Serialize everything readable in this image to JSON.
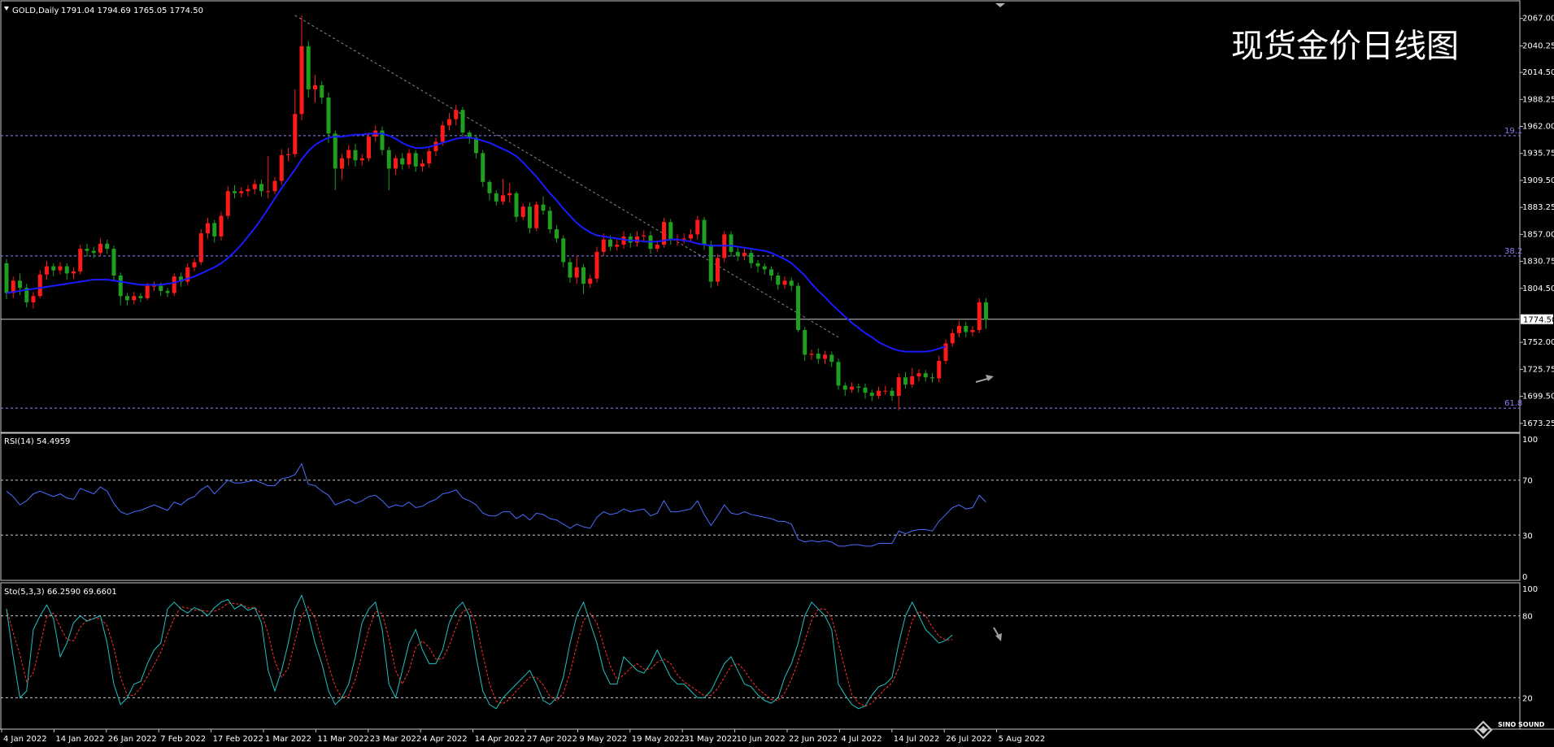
{
  "header": {
    "symbol": "GOLD,Daily",
    "ohlc": "1791.04 1794.69 1765.05 1774.50",
    "annotation": "现货金价日线图"
  },
  "colors": {
    "background": "#000000",
    "bull": "#ff1a1a",
    "bear": "#1f9e1f",
    "ma": "#1a1aff",
    "rsi": "#4a6cff",
    "sto_main": "#20c0c0",
    "sto_signal": "#ff3030",
    "grid_dash": "#8a8aff",
    "trendline": "#8a8a8a",
    "arrow": "#a0a0a0"
  },
  "price_panel": {
    "ticks": [
      "2067.00",
      "2040.25",
      "2014.50",
      "1988.25",
      "1962.00",
      "1935.75",
      "1909.50",
      "1883.25",
      "1857.00",
      "1830.75",
      "1804.50",
      "1752.00",
      "1725.75",
      "1699.50",
      "1673.25"
    ],
    "current_price_label": "1774.50",
    "fib_levels": [
      {
        "label": "19.1",
        "price": 1953
      },
      {
        "label": "38.2",
        "price": 1836
      },
      {
        "label": "61.8",
        "price": 1688
      }
    ]
  },
  "rsi_panel": {
    "label": "RSI(14) 54.4959",
    "ticks": [
      "100",
      "70",
      "30",
      "0"
    ]
  },
  "sto_panel": {
    "label": "Sto(5,3,3) 66.2590 69.6601",
    "ticks": [
      "100",
      "80",
      "20"
    ]
  },
  "x_axis": {
    "dates": [
      "4 Jan 2022",
      "14 Jan 2022",
      "26 Jan 2022",
      "7 Feb 2022",
      "17 Feb 2022",
      "1 Mar 2022",
      "11 Mar 2022",
      "23 Mar 2022",
      "4 Apr 2022",
      "14 Apr 2022",
      "27 Apr 2022",
      "9 May 2022",
      "19 May 2022",
      "31 May 2022",
      "10 Jun 2022",
      "22 Jun 2022",
      "4 Jul 2022",
      "14 Jul 2022",
      "26 Jul 2022",
      "5 Aug 2022"
    ]
  },
  "logo": {
    "text": "SINO SOUND"
  },
  "chart_data": {
    "type": "candlestick",
    "price_ylim": [
      1666,
      2077
    ],
    "rsi_ylim": [
      0,
      100
    ],
    "sto_ylim": [
      0,
      100
    ],
    "candles": [
      [
        1829,
        1800,
        1833,
        1794
      ],
      [
        1800,
        1812,
        1816,
        1795
      ],
      [
        1812,
        1805,
        1819,
        1798
      ],
      [
        1805,
        1791,
        1809,
        1786
      ],
      [
        1791,
        1797,
        1801,
        1785
      ],
      [
        1797,
        1818,
        1822,
        1795
      ],
      [
        1818,
        1826,
        1831,
        1813
      ],
      [
        1826,
        1822,
        1829,
        1816
      ],
      [
        1822,
        1826,
        1830,
        1818
      ],
      [
        1826,
        1819,
        1829,
        1813
      ],
      [
        1819,
        1821,
        1825,
        1814
      ],
      [
        1821,
        1843,
        1847,
        1818
      ],
      [
        1843,
        1841,
        1848,
        1835
      ],
      [
        1841,
        1839,
        1845,
        1834
      ],
      [
        1839,
        1848,
        1853,
        1836
      ],
      [
        1848,
        1843,
        1852,
        1838
      ],
      [
        1843,
        1817,
        1846,
        1812
      ],
      [
        1817,
        1797,
        1820,
        1788
      ],
      [
        1797,
        1793,
        1800,
        1788
      ],
      [
        1793,
        1797,
        1801,
        1789
      ],
      [
        1797,
        1795,
        1800,
        1791
      ],
      [
        1795,
        1807,
        1810,
        1793
      ],
      [
        1807,
        1807,
        1811,
        1802
      ],
      [
        1807,
        1802,
        1810,
        1797
      ],
      [
        1802,
        1800,
        1805,
        1796
      ],
      [
        1800,
        1816,
        1819,
        1797
      ],
      [
        1816,
        1811,
        1820,
        1806
      ],
      [
        1811,
        1825,
        1829,
        1808
      ],
      [
        1825,
        1830,
        1834,
        1821
      ],
      [
        1830,
        1858,
        1862,
        1827
      ],
      [
        1858,
        1868,
        1873,
        1853
      ],
      [
        1868,
        1855,
        1871,
        1849
      ],
      [
        1855,
        1875,
        1879,
        1851
      ],
      [
        1875,
        1899,
        1904,
        1872
      ],
      [
        1899,
        1897,
        1905,
        1892
      ],
      [
        1897,
        1899,
        1903,
        1893
      ],
      [
        1899,
        1901,
        1905,
        1894
      ],
      [
        1901,
        1906,
        1910,
        1896
      ],
      [
        1906,
        1899,
        1910,
        1894
      ],
      [
        1899,
        1899,
        1933,
        1892
      ],
      [
        1899,
        1909,
        1913,
        1896
      ],
      [
        1909,
        1934,
        1940,
        1905
      ],
      [
        1934,
        1935,
        1941,
        1928
      ],
      [
        1935,
        1974,
        1998,
        1932
      ],
      [
        1974,
        2040,
        2070,
        1968
      ],
      [
        2040,
        1998,
        2045,
        1990
      ],
      [
        1998,
        2002,
        2012,
        1985
      ],
      [
        2002,
        1990,
        2006,
        1984
      ],
      [
        1990,
        1955,
        1995,
        1946
      ],
      [
        1955,
        1921,
        1958,
        1900
      ],
      [
        1921,
        1931,
        1935,
        1910
      ],
      [
        1931,
        1939,
        1944,
        1924
      ],
      [
        1939,
        1929,
        1945,
        1923
      ],
      [
        1929,
        1931,
        1935,
        1924
      ],
      [
        1931,
        1952,
        1956,
        1928
      ],
      [
        1952,
        1958,
        1963,
        1947
      ],
      [
        1958,
        1939,
        1962,
        1934
      ],
      [
        1939,
        1921,
        1942,
        1900
      ],
      [
        1921,
        1931,
        1934,
        1915
      ],
      [
        1931,
        1925,
        1936,
        1920
      ],
      [
        1925,
        1936,
        1940,
        1921
      ],
      [
        1936,
        1923,
        1939,
        1918
      ],
      [
        1923,
        1926,
        1930,
        1918
      ],
      [
        1926,
        1938,
        1941,
        1922
      ],
      [
        1938,
        1947,
        1951,
        1933
      ],
      [
        1947,
        1963,
        1967,
        1943
      ],
      [
        1963,
        1969,
        1975,
        1958
      ],
      [
        1969,
        1978,
        1983,
        1963
      ],
      [
        1978,
        1956,
        1981,
        1952
      ],
      [
        1956,
        1951,
        1958,
        1945
      ],
      [
        1951,
        1936,
        1954,
        1931
      ],
      [
        1936,
        1908,
        1939,
        1903
      ],
      [
        1908,
        1897,
        1910,
        1890
      ],
      [
        1897,
        1889,
        1900,
        1885
      ],
      [
        1889,
        1895,
        1911,
        1886
      ],
      [
        1895,
        1897,
        1907,
        1888
      ],
      [
        1897,
        1874,
        1899,
        1869
      ],
      [
        1874,
        1884,
        1887,
        1871
      ],
      [
        1884,
        1863,
        1888,
        1858
      ],
      [
        1863,
        1886,
        1889,
        1860
      ],
      [
        1886,
        1880,
        1894,
        1876
      ],
      [
        1880,
        1862,
        1884,
        1858
      ],
      [
        1862,
        1853,
        1866,
        1849
      ],
      [
        1853,
        1830,
        1856,
        1825
      ],
      [
        1830,
        1815,
        1834,
        1810
      ],
      [
        1815,
        1825,
        1836,
        1809
      ],
      [
        1825,
        1809,
        1828,
        1799
      ],
      [
        1809,
        1814,
        1818,
        1805
      ],
      [
        1814,
        1840,
        1845,
        1810
      ],
      [
        1840,
        1852,
        1858,
        1836
      ],
      [
        1852,
        1845,
        1856,
        1841
      ],
      [
        1845,
        1847,
        1852,
        1841
      ],
      [
        1847,
        1855,
        1860,
        1843
      ],
      [
        1855,
        1849,
        1858,
        1844
      ],
      [
        1849,
        1855,
        1860,
        1845
      ],
      [
        1855,
        1856,
        1861,
        1851
      ],
      [
        1856,
        1843,
        1860,
        1838
      ],
      [
        1843,
        1847,
        1851,
        1840
      ],
      [
        1847,
        1869,
        1873,
        1844
      ],
      [
        1869,
        1852,
        1872,
        1847
      ],
      [
        1852,
        1852,
        1857,
        1846
      ],
      [
        1852,
        1853,
        1858,
        1848
      ],
      [
        1853,
        1857,
        1862,
        1849
      ],
      [
        1857,
        1871,
        1875,
        1852
      ],
      [
        1871,
        1847,
        1874,
        1842
      ],
      [
        1847,
        1811,
        1851,
        1805
      ],
      [
        1811,
        1834,
        1838,
        1807
      ],
      [
        1834,
        1857,
        1860,
        1830
      ],
      [
        1857,
        1840,
        1860,
        1835
      ],
      [
        1840,
        1836,
        1844,
        1831
      ],
      [
        1836,
        1839,
        1843,
        1832
      ],
      [
        1839,
        1829,
        1842,
        1824
      ],
      [
        1829,
        1826,
        1832,
        1820
      ],
      [
        1826,
        1823,
        1829,
        1818
      ],
      [
        1823,
        1817,
        1826,
        1812
      ],
      [
        1817,
        1808,
        1820,
        1803
      ],
      [
        1808,
        1812,
        1816,
        1804
      ],
      [
        1812,
        1807,
        1815,
        1802
      ],
      [
        1807,
        1764,
        1810,
        1762
      ],
      [
        1764,
        1740,
        1767,
        1734
      ],
      [
        1740,
        1741,
        1745,
        1735
      ],
      [
        1741,
        1736,
        1746,
        1731
      ],
      [
        1736,
        1740,
        1744,
        1731
      ],
      [
        1740,
        1733,
        1743,
        1728
      ],
      [
        1733,
        1710,
        1736,
        1706
      ],
      [
        1710,
        1706,
        1713,
        1700
      ],
      [
        1706,
        1709,
        1713,
        1703
      ],
      [
        1709,
        1708,
        1712,
        1703
      ],
      [
        1708,
        1703,
        1712,
        1697
      ],
      [
        1703,
        1700,
        1706,
        1695
      ],
      [
        1700,
        1705,
        1709,
        1697
      ],
      [
        1705,
        1705,
        1710,
        1701
      ],
      [
        1705,
        1700,
        1708,
        1695
      ],
      [
        1700,
        1718,
        1722,
        1686
      ],
      [
        1718,
        1711,
        1723,
        1707
      ],
      [
        1711,
        1719,
        1727,
        1708
      ],
      [
        1719,
        1722,
        1726,
        1714
      ],
      [
        1722,
        1718,
        1725,
        1714
      ],
      [
        1718,
        1717,
        1722,
        1713
      ],
      [
        1717,
        1734,
        1739,
        1713
      ],
      [
        1734,
        1751,
        1755,
        1731
      ],
      [
        1751,
        1761,
        1765,
        1748
      ],
      [
        1761,
        1768,
        1773,
        1757
      ],
      [
        1768,
        1762,
        1772,
        1757
      ],
      [
        1762,
        1764,
        1768,
        1758
      ],
      [
        1764,
        1791,
        1795,
        1761
      ],
      [
        1791,
        1774,
        1795,
        1765
      ]
    ],
    "ma": [
      1800,
      1801,
      1802,
      1803,
      1804,
      1805,
      1806,
      1807,
      1808,
      1809,
      1810,
      1811,
      1812,
      1813,
      1813,
      1813,
      1812,
      1811,
      1810,
      1809,
      1808,
      1808,
      1808,
      1808,
      1809,
      1810,
      1812,
      1814,
      1816,
      1819,
      1822,
      1825,
      1829,
      1834,
      1840,
      1847,
      1855,
      1863,
      1872,
      1882,
      1892,
      1902,
      1911,
      1920,
      1930,
      1938,
      1944,
      1948,
      1951,
      1952,
      1952,
      1953,
      1954,
      1954,
      1955,
      1955,
      1955,
      1953,
      1950,
      1946,
      1943,
      1941,
      1941,
      1942,
      1944,
      1946,
      1948,
      1950,
      1951,
      1951,
      1950,
      1948,
      1946,
      1943,
      1940,
      1937,
      1933,
      1927,
      1920,
      1913,
      1905,
      1897,
      1890,
      1882,
      1875,
      1868,
      1863,
      1859,
      1856,
      1855,
      1854,
      1853,
      1852,
      1851,
      1851,
      1850,
      1850,
      1850,
      1851,
      1852,
      1852,
      1851,
      1850,
      1848,
      1847,
      1846,
      1846,
      1846,
      1846,
      1845,
      1844,
      1843,
      1842,
      1841,
      1839,
      1836,
      1833,
      1829,
      1823,
      1817,
      1809,
      1802,
      1796,
      1789,
      1783,
      1777,
      1771,
      1766,
      1761,
      1757,
      1752,
      1749,
      1746,
      1744,
      1743,
      1743,
      1743,
      1743,
      1744,
      1746,
      1748
    ],
    "rsi": [
      62,
      58,
      52,
      55,
      60,
      62,
      60,
      58,
      60,
      57,
      56,
      64,
      62,
      60,
      65,
      62,
      53,
      47,
      45,
      47,
      48,
      50,
      52,
      50,
      48,
      54,
      52,
      56,
      58,
      63,
      66,
      60,
      65,
      70,
      68,
      68,
      69,
      70,
      68,
      66,
      66,
      71,
      72,
      74,
      82,
      67,
      66,
      62,
      59,
      52,
      54,
      56,
      53,
      55,
      58,
      59,
      55,
      50,
      52,
      51,
      54,
      50,
      51,
      54,
      56,
      60,
      61,
      63,
      57,
      55,
      52,
      46,
      44,
      44,
      47,
      47,
      42,
      45,
      41,
      46,
      45,
      42,
      41,
      38,
      35,
      38,
      36,
      35,
      43,
      47,
      45,
      46,
      49,
      47,
      48,
      49,
      44,
      46,
      55,
      47,
      47,
      48,
      49,
      55,
      45,
      37,
      44,
      52,
      46,
      45,
      47,
      45,
      44,
      43,
      42,
      40,
      40,
      38,
      27,
      25,
      26,
      25,
      26,
      25,
      22,
      22,
      23,
      23,
      22,
      22,
      24,
      24,
      24,
      33,
      31,
      33,
      34,
      34,
      33,
      40,
      45,
      50,
      52,
      49,
      50,
      59,
      54
    ],
    "sto_main": [
      85,
      50,
      20,
      25,
      70,
      80,
      88,
      78,
      50,
      60,
      75,
      80,
      76,
      78,
      80,
      60,
      30,
      15,
      20,
      30,
      32,
      45,
      55,
      60,
      85,
      90,
      85,
      82,
      86,
      84,
      80,
      86,
      90,
      92,
      85,
      88,
      84,
      86,
      75,
      40,
      25,
      40,
      60,
      85,
      95,
      80,
      60,
      45,
      25,
      15,
      20,
      30,
      50,
      75,
      85,
      90,
      70,
      30,
      20,
      40,
      60,
      70,
      55,
      45,
      45,
      55,
      75,
      85,
      90,
      80,
      50,
      25,
      15,
      12,
      20,
      25,
      30,
      35,
      40,
      30,
      18,
      15,
      20,
      35,
      60,
      80,
      90,
      75,
      60,
      40,
      30,
      30,
      50,
      45,
      40,
      38,
      45,
      55,
      45,
      35,
      30,
      30,
      25,
      20,
      20,
      25,
      35,
      45,
      50,
      40,
      30,
      28,
      22,
      18,
      16,
      20,
      35,
      45,
      60,
      80,
      90,
      85,
      80,
      70,
      30,
      22,
      15,
      12,
      14,
      22,
      28,
      30,
      35,
      60,
      80,
      90,
      80,
      70,
      65,
      60,
      62,
      66
    ]
  }
}
